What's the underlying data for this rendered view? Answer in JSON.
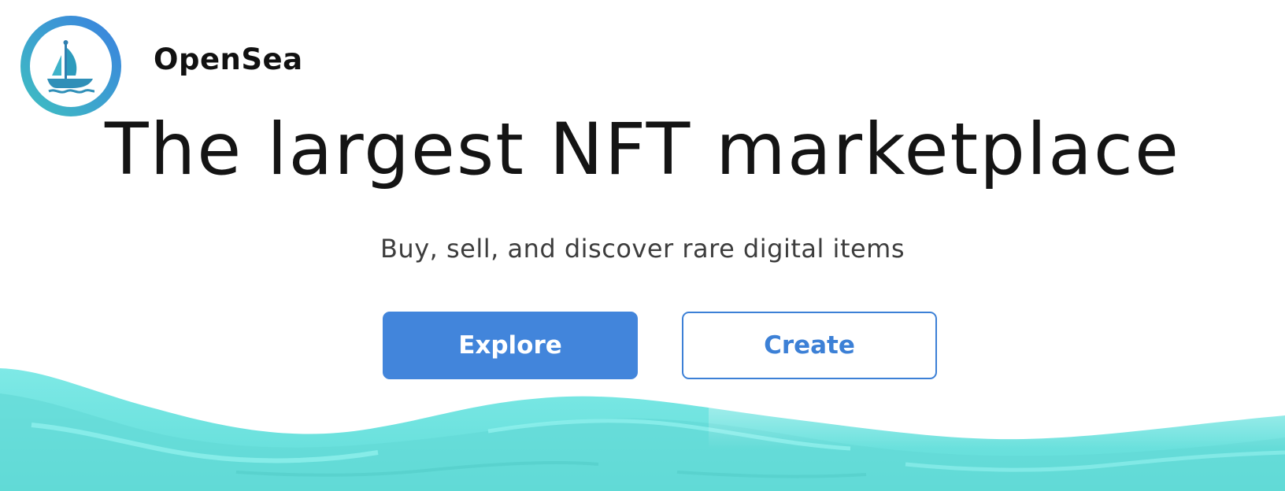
{
  "brand": {
    "name": "OpenSea",
    "logo_icon": "opensea-ship-logo-icon"
  },
  "hero": {
    "headline": "The largest NFT marketplace",
    "subheadline": "Buy, sell, and discover rare digital items"
  },
  "actions": {
    "explore_label": "Explore",
    "create_label": "Create"
  },
  "colors": {
    "primary": "#4285db",
    "wave": "#6fe3df",
    "logo_ring": "#3e8ad8"
  },
  "decoration": {
    "background_icon": "ocean-waves-decoration"
  }
}
